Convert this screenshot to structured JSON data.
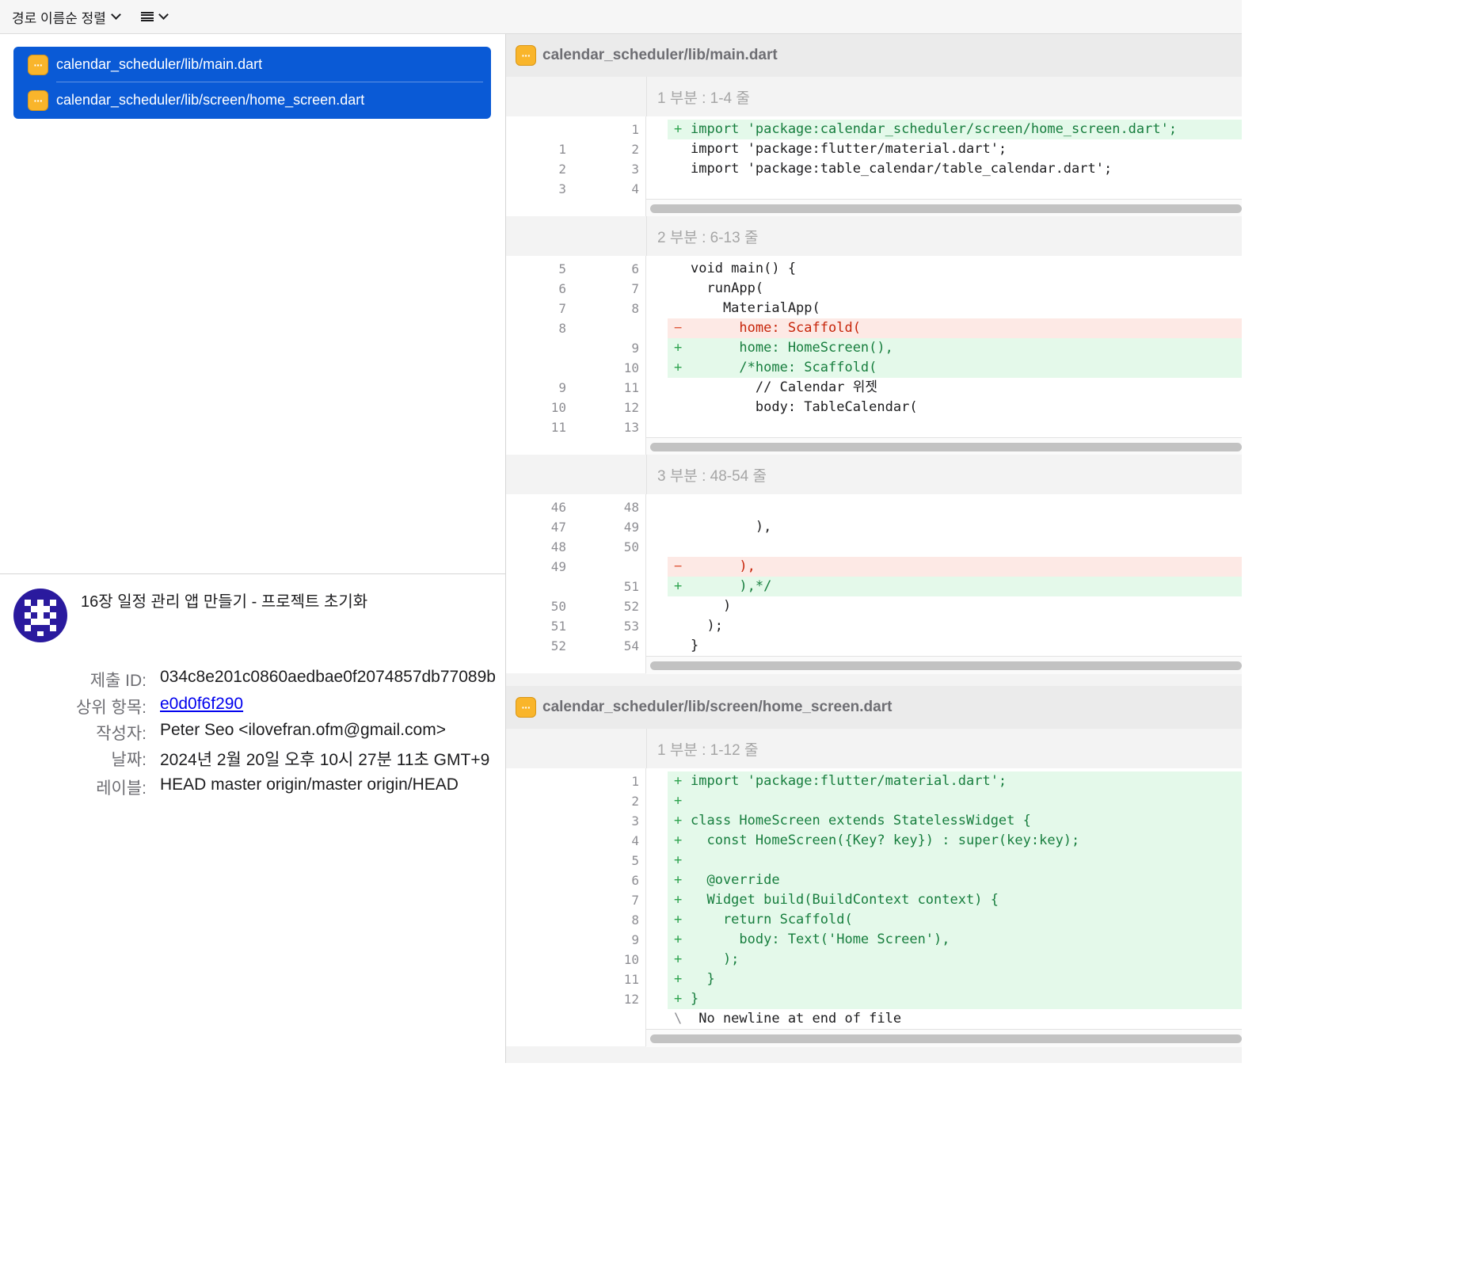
{
  "toolbar": {
    "sort_label": "경로 이름순 정렬"
  },
  "files": [
    {
      "path": "calendar_scheduler/lib/main.dart"
    },
    {
      "path": "calendar_scheduler/lib/screen/home_screen.dart"
    }
  ],
  "commit": {
    "title": "16장 일정 관리 앱 만들기 - 프로젝트 초기화",
    "fields": [
      {
        "label": "제출 ID:",
        "value": "034c8e201c0860aedbae0f2074857db77089b"
      },
      {
        "label": "상위 항목:",
        "value": "e0d0f6f290"
      },
      {
        "label": "작성자:",
        "value": "Peter Seo <ilovefran.ofm@gmail.com>"
      },
      {
        "label": "날짜:",
        "value": "2024년 2월 20일 오후 10시 27분 11초 GMT+9"
      },
      {
        "label": "레이블:",
        "value": "HEAD master origin/master origin/HEAD"
      }
    ]
  },
  "diff": {
    "files": [
      {
        "name": "calendar_scheduler/lib/main.dart",
        "hunks": [
          {
            "header": "1 부분 : 1-4 줄",
            "lines": [
              {
                "type": "add",
                "old": "",
                "new": "1",
                "mark": "+",
                "text": "import 'package:calendar_scheduler/screen/home_screen.dart';"
              },
              {
                "type": "ctx",
                "old": "1",
                "new": "2",
                "mark": "",
                "text": "import 'package:flutter/material.dart';"
              },
              {
                "type": "ctx",
                "old": "2",
                "new": "3",
                "mark": "",
                "text": "import 'package:table_calendar/table_calendar.dart';"
              },
              {
                "type": "ctx",
                "old": "3",
                "new": "4",
                "mark": "",
                "text": ""
              }
            ]
          },
          {
            "header": "2 부분 : 6-13 줄",
            "lines": [
              {
                "type": "ctx",
                "old": "5",
                "new": "6",
                "mark": "",
                "text": "void main() {"
              },
              {
                "type": "ctx",
                "old": "6",
                "new": "7",
                "mark": "",
                "text": "  runApp("
              },
              {
                "type": "ctx",
                "old": "7",
                "new": "8",
                "mark": "",
                "text": "    MaterialApp("
              },
              {
                "type": "del",
                "old": "8",
                "new": "",
                "mark": "−",
                "text": "      home: Scaffold("
              },
              {
                "type": "add",
                "old": "",
                "new": "9",
                "mark": "+",
                "text": "      home: HomeScreen(),"
              },
              {
                "type": "add",
                "old": "",
                "new": "10",
                "mark": "+",
                "text": "      /*home: Scaffold("
              },
              {
                "type": "ctx",
                "old": "9",
                "new": "11",
                "mark": "",
                "text": "        // Calendar 위젯"
              },
              {
                "type": "ctx",
                "old": "10",
                "new": "12",
                "mark": "",
                "text": "        body: TableCalendar("
              },
              {
                "type": "ctx",
                "old": "11",
                "new": "13",
                "mark": "",
                "text": ""
              }
            ]
          },
          {
            "header": "3 부분 : 48-54 줄",
            "lines": [
              {
                "type": "ctx",
                "old": "46",
                "new": "48",
                "mark": "",
                "text": ""
              },
              {
                "type": "ctx",
                "old": "47",
                "new": "49",
                "mark": "",
                "text": "        ),"
              },
              {
                "type": "ctx",
                "old": "48",
                "new": "50",
                "mark": "",
                "text": ""
              },
              {
                "type": "del",
                "old": "49",
                "new": "",
                "mark": "−",
                "text": "      ),"
              },
              {
                "type": "add",
                "old": "",
                "new": "51",
                "mark": "+",
                "text": "      ),*/"
              },
              {
                "type": "ctx",
                "old": "50",
                "new": "52",
                "mark": "",
                "text": "    )"
              },
              {
                "type": "ctx",
                "old": "51",
                "new": "53",
                "mark": "",
                "text": "  );"
              },
              {
                "type": "ctx",
                "old": "52",
                "new": "54",
                "mark": "",
                "text": "}"
              }
            ]
          }
        ]
      },
      {
        "name": "calendar_scheduler/lib/screen/home_screen.dart",
        "hunks": [
          {
            "header": "1 부분 : 1-12 줄",
            "lines": [
              {
                "type": "add",
                "old": "",
                "new": "1",
                "mark": "+",
                "text": "import 'package:flutter/material.dart';"
              },
              {
                "type": "add",
                "old": "",
                "new": "2",
                "mark": "+",
                "text": ""
              },
              {
                "type": "add",
                "old": "",
                "new": "3",
                "mark": "+",
                "text": "class HomeScreen extends StatelessWidget {"
              },
              {
                "type": "add",
                "old": "",
                "new": "4",
                "mark": "+",
                "text": "  const HomeScreen({Key? key}) : super(key:key);"
              },
              {
                "type": "add",
                "old": "",
                "new": "5",
                "mark": "+",
                "text": ""
              },
              {
                "type": "add",
                "old": "",
                "new": "6",
                "mark": "+",
                "text": "  @override"
              },
              {
                "type": "add",
                "old": "",
                "new": "7",
                "mark": "+",
                "text": "  Widget build(BuildContext context) {"
              },
              {
                "type": "add",
                "old": "",
                "new": "8",
                "mark": "+",
                "text": "    return Scaffold("
              },
              {
                "type": "add",
                "old": "",
                "new": "9",
                "mark": "+",
                "text": "      body: Text('Home Screen'),"
              },
              {
                "type": "add",
                "old": "",
                "new": "10",
                "mark": "+",
                "text": "    );"
              },
              {
                "type": "add",
                "old": "",
                "new": "11",
                "mark": "+",
                "text": "  }"
              },
              {
                "type": "add",
                "old": "",
                "new": "12",
                "mark": "+",
                "text": "}"
              },
              {
                "type": "note",
                "old": "",
                "new": "",
                "mark": "\\",
                "text": " No newline at end of file"
              }
            ]
          }
        ]
      }
    ]
  },
  "icons": {
    "file_icon": "ellipsis-file-icon",
    "sort_chevron": "chevron-down-icon",
    "list_menu": "list-icon"
  },
  "colors": {
    "selection": "#0a5ad6",
    "file_icon": "#f9b52b",
    "added_bg": "#e4f9ea",
    "added_text": "#177e3e",
    "removed_bg": "#fde9e5",
    "removed_text": "#c7250a",
    "link": "#0000ee"
  }
}
